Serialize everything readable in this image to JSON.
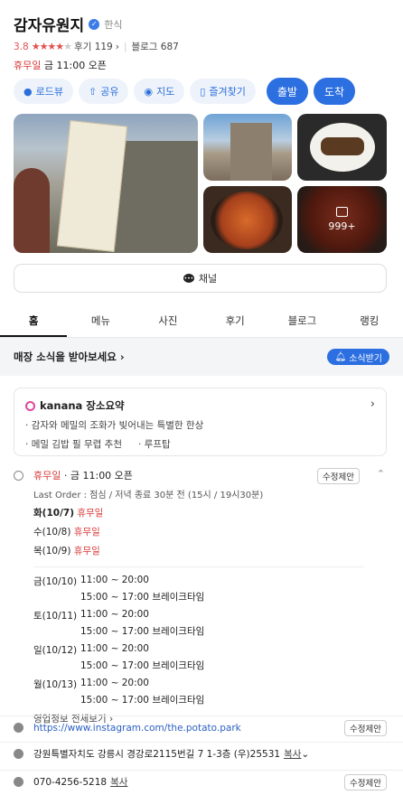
{
  "place": {
    "name": "감자유원지",
    "category": "한식",
    "rating": "3.8",
    "reviews": "후기 119",
    "blogs": "블로그 687",
    "status": "휴무일",
    "open_time": "금 11:00 오픈"
  },
  "actions": [
    {
      "label": "로드뷰",
      "icon": "roadview-icon"
    },
    {
      "label": "공유",
      "icon": "share-icon"
    },
    {
      "label": "지도",
      "icon": "map-pin-icon"
    },
    {
      "label": "즐겨찾기",
      "icon": "bookmark-icon"
    }
  ],
  "primary_actions": {
    "depart": "출발",
    "arrive": "도착"
  },
  "photos": {
    "more_count": "999+"
  },
  "channel_label": "채널",
  "tabs": [
    "홈",
    "메뉴",
    "사진",
    "후기",
    "블로그",
    "랭킹"
  ],
  "subscribe": {
    "text": "매장 소식을 받아보세요",
    "button": "소식받기"
  },
  "summary": {
    "title": "kanana 장소요약",
    "lines": [
      [
        "감자와 메밀의 조화가 빚어내는 특별한 한상"
      ],
      [
        "메밀 김밥 필 무렵 추천",
        "루프탑"
      ]
    ]
  },
  "hours": {
    "status": "휴무일",
    "open": "· 금 11:00 오픈",
    "edit": "수정제안",
    "last_order": "Last Order : 점심 / 저녁 종료 30분 전 (15시 / 19시30분)",
    "closed_days": [
      {
        "day": "화(10/7)",
        "status": "휴무일"
      },
      {
        "day": "수(10/8)",
        "status": "휴무일"
      },
      {
        "day": "목(10/9)",
        "status": "휴무일"
      }
    ],
    "schedule": [
      {
        "day": "금(10/10)",
        "t1": "11:00 ~ 20:00",
        "t2": "15:00 ~ 17:00 브레이크타임"
      },
      {
        "day": "토(10/11)",
        "t1": "11:00 ~ 20:00",
        "t2": "15:00 ~ 17:00 브레이크타임"
      },
      {
        "day": "일(10/12)",
        "t1": "11:00 ~ 20:00",
        "t2": "15:00 ~ 17:00 브레이크타임"
      },
      {
        "day": "월(10/13)",
        "t1": "11:00 ~ 20:00",
        "t2": "15:00 ~ 17:00 브레이크타임"
      }
    ],
    "more": "영업정보 전체보기 ›"
  },
  "info": {
    "url": "https://www.instagram.com/the.potato.park",
    "address": "강원특별자치도 강릉시 경강로2115번길 7 1-3층 (우)25531",
    "phone": "070-4256-5218",
    "copy": "복사",
    "edit": "수정제안"
  },
  "colors": {
    "accent": "#2c6fe0",
    "closed": "#d93838",
    "star": "#e2514f"
  }
}
